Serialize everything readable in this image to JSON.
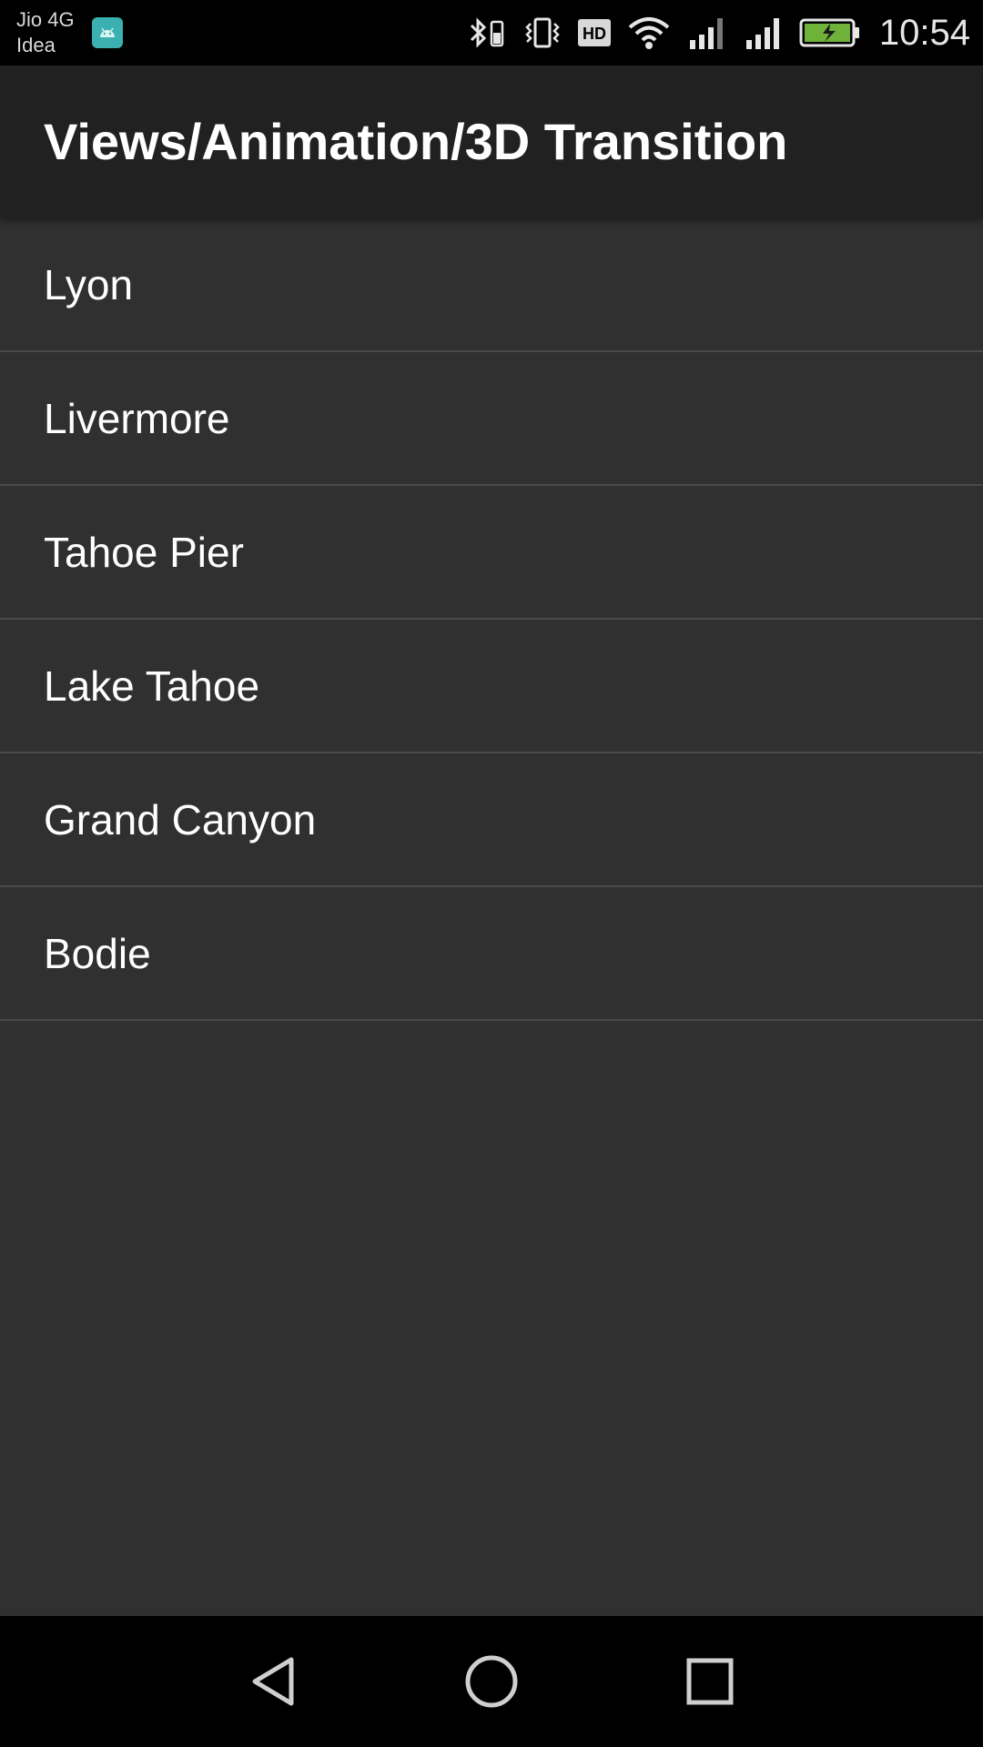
{
  "status_bar": {
    "carrier_line1": "Jio 4G",
    "carrier_line2": "Idea",
    "time": "10:54",
    "icons": [
      "android-notification-icon",
      "bluetooth-icon",
      "vibrate-icon",
      "hd-icon",
      "wifi-icon",
      "signal-icon",
      "signal-icon",
      "battery-charging-icon"
    ],
    "hd_label": "HD",
    "battery_color": "#6fb23a"
  },
  "action_bar": {
    "title": "Views/Animation/3D Transition"
  },
  "list": {
    "items": [
      {
        "label": "Lyon"
      },
      {
        "label": "Livermore"
      },
      {
        "label": "Tahoe Pier"
      },
      {
        "label": "Lake Tahoe"
      },
      {
        "label": "Grand Canyon"
      },
      {
        "label": "Bodie"
      }
    ]
  },
  "nav_bar": {
    "buttons": [
      "back-icon",
      "home-icon",
      "recents-icon"
    ]
  }
}
